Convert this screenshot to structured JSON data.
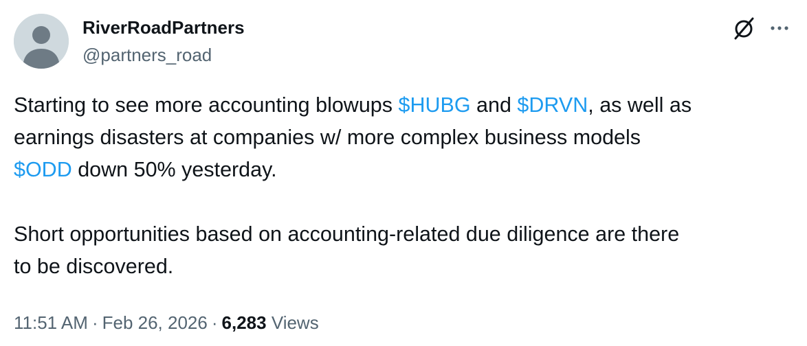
{
  "author": {
    "display_name": "RiverRoadPartners",
    "handle": "@partners_road",
    "avatar_icon": "default-profile-icon",
    "avatar_bg": "#cfd9de",
    "avatar_fg": "#6e7b85"
  },
  "actions": {
    "grok_icon": "grok-icon",
    "more_icon": "more-horizontal-icon"
  },
  "tweet": {
    "p1": {
      "t1": "Starting to see more accounting blowups ",
      "tag1": "$HUBG",
      "t2": " and ",
      "tag2": "$DRVN",
      "t3": ", as well as",
      "t4": "earnings disasters at companies w/ more complex business models",
      "tag3": "$ODD",
      "t5": " down 50% yesterday."
    },
    "p2": {
      "line1": "Short opportunities based on accounting-related due diligence are there",
      "line2": "to be discovered."
    }
  },
  "meta": {
    "time": "11:51 AM",
    "separator": "·",
    "date": "Feb 26, 2026",
    "views_count": "6,283",
    "views_label": "Views"
  },
  "colors": {
    "text": "#0f1419",
    "secondary": "#536471",
    "link": "#1d9bf0"
  }
}
